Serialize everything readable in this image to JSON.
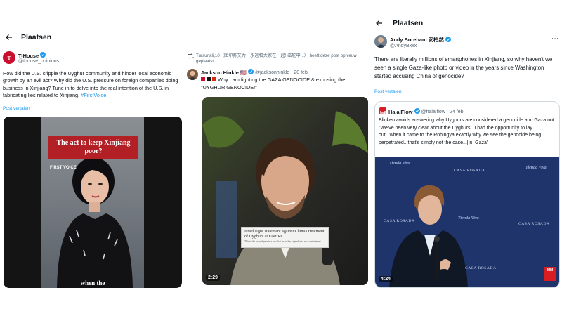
{
  "colors": {
    "accent": "#1d9bf0",
    "text": "#0f1419",
    "muted": "#536471",
    "caption_red": "#b21f24"
  },
  "panel1": {
    "header": {
      "title": "Plaatsen",
      "back_icon": "arrow-left-icon"
    },
    "tweet": {
      "name": "T-House",
      "handle": "@thouse_opinions",
      "text": "How did the U.S. cripple the Uyghur community and hinder local economic growth by an evil act? Why did the U.S. pressure on foreign companies doing business in Xinjiang? Tune in to delve into the real intention of the U.S. in fabricating lies related to Xinjiang.",
      "hashtag": "#FirstVoice",
      "translate": "Post vertalen",
      "more": "···"
    },
    "video": {
      "caption_top": "The act to keep Xinjiang poor?",
      "caption_bottom": "when the",
      "logo": "FIRST VOICE"
    }
  },
  "panel2": {
    "repost": {
      "text": "Tursunali,10（图尔荪艾力，永远和大家在一起! 磁舵中...） heeft deze post opnieuw geplaatst"
    },
    "tweet": {
      "name": "Jackson Hinkle",
      "flags": "🇺🇸",
      "handle": "@jacksonhinkle · 20 feb.",
      "text": "Why I am fighting the GAZA GENOCIDE & exposing the \"UYGHUR GENOCIDE!\"",
      "more": "···"
    },
    "video": {
      "label_title": "Israel signs statement against China's treatment of Uyghurs at UNHRC",
      "label_sub": "This is the second year in a row that Israel has signed onto such a statement.",
      "duration": "2:29"
    }
  },
  "panel3": {
    "header": {
      "title": "Plaatsen",
      "back_icon": "arrow-left-icon"
    },
    "tweet": {
      "name": "Andy Boreham 安柏然",
      "handle": "@AndyBxxx",
      "text": "There are literally millions of smartphones in Xinjiang, so why haven't we seen a single Gaza-like photo or video in the years since Washington started accusing China of genocide?",
      "translate": "Post vertalen",
      "more": "···"
    },
    "quote": {
      "name": "HalalFlow",
      "handle": "@halalflow · 24 feb.",
      "text": "Blinken avoids answering why Uyghurs are considered a genocide and Gaza not: \"We've been very clear about the Uyghurs...I had the opportunity to lay out...when it came to the Rohingya exactly why we see the genocide being perpetrated...that's simply not the case...[in] Gaza\"",
      "casa_label": "CASA ROSADA",
      "backdrop_brand": "Tienda Viva",
      "logo": "MM",
      "duration": "4:24"
    }
  }
}
